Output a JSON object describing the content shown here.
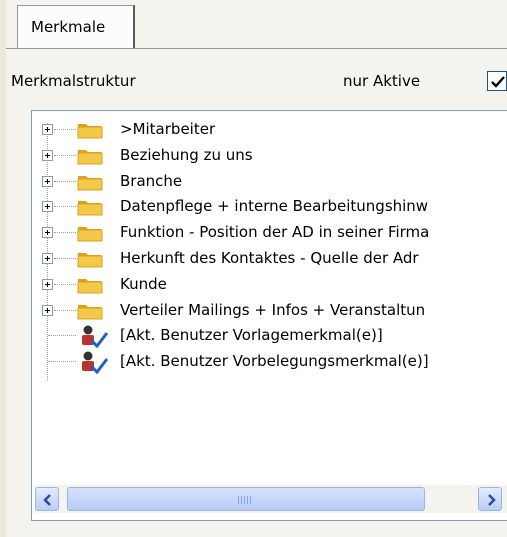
{
  "tab": {
    "label": "Merkmale"
  },
  "header": {
    "structure_label": "Merkmalstruktur",
    "active_only_label": "nur Aktive",
    "active_only_checked": true
  },
  "tree": {
    "items": [
      {
        "label": ">Mitarbeiter",
        "icon": "folder-icon",
        "expandable": true
      },
      {
        "label": "Beziehung zu uns",
        "icon": "folder-icon",
        "expandable": true
      },
      {
        "label": "Branche",
        "icon": "folder-icon",
        "expandable": true
      },
      {
        "label": "Datenpflege + interne Bearbeitungshinw",
        "icon": "folder-icon",
        "expandable": true
      },
      {
        "label": "Funktion - Position der AD in seiner Firma",
        "icon": "folder-icon",
        "expandable": true
      },
      {
        "label": "Herkunft des Kontaktes - Quelle der Adr",
        "icon": "folder-icon",
        "expandable": true
      },
      {
        "label": "Kunde",
        "icon": "folder-icon",
        "expandable": true
      },
      {
        "label": "Verteiler Mailings + Infos + Veranstaltun",
        "icon": "folder-icon",
        "expandable": true
      },
      {
        "label": "[Akt. Benutzer Vorlagemerkmal(e)]",
        "icon": "user-check-icon",
        "expandable": false
      },
      {
        "label": "[Akt. Benutzer Vorbelegungsmerkmal(e)]",
        "icon": "user-check-icon",
        "expandable": false
      }
    ]
  },
  "scrollbar": {
    "left_icon": "arrow-left-icon",
    "right_icon": "arrow-right-icon"
  },
  "colors": {
    "folder": "#f4c94a",
    "folder_dark": "#d9a21a",
    "check": "#1f5fc8",
    "user": "#c0302a"
  }
}
